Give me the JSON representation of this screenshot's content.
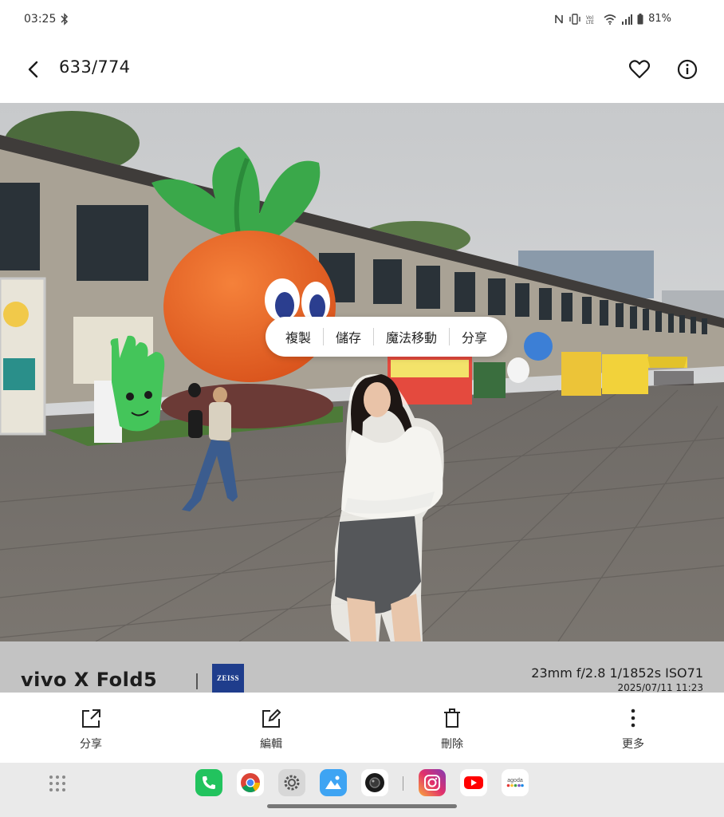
{
  "status_bar": {
    "time": "03:25",
    "battery": "81%",
    "icons": [
      "bluetooth-icon",
      "nfc-icon",
      "vibrate-icon",
      "lte-icon",
      "wifi-icon",
      "signal-icon",
      "battery-icon"
    ]
  },
  "header": {
    "counter": "633/774",
    "icons": [
      "back-arrow-icon",
      "heart-icon",
      "info-icon"
    ]
  },
  "popup_menu": {
    "items": [
      "複製",
      "儲存",
      "魔法移動",
      "分享"
    ]
  },
  "watermark": {
    "brand": "vivo X Fold5",
    "lens_logo": "ZEISS",
    "specs": "23mm  f/2.8  1/1852s  ISO71",
    "datetime": "2025/07/11 11:23",
    "colors": {
      "strip": "#c3c3c3",
      "zeiss": "#1f3d8c"
    }
  },
  "actions": {
    "share": "分享",
    "edit": "編輯",
    "delete": "刪除",
    "more": "更多"
  },
  "taskbar": {
    "apps": [
      "app-drawer-icon",
      "phone-app-icon",
      "chrome-app-icon",
      "settings-app-icon",
      "gallery-app-icon",
      "camera-app-icon",
      "instagram-app-icon",
      "youtube-app-icon",
      "agoda-app-icon"
    ],
    "agoda_label": "agoda"
  }
}
